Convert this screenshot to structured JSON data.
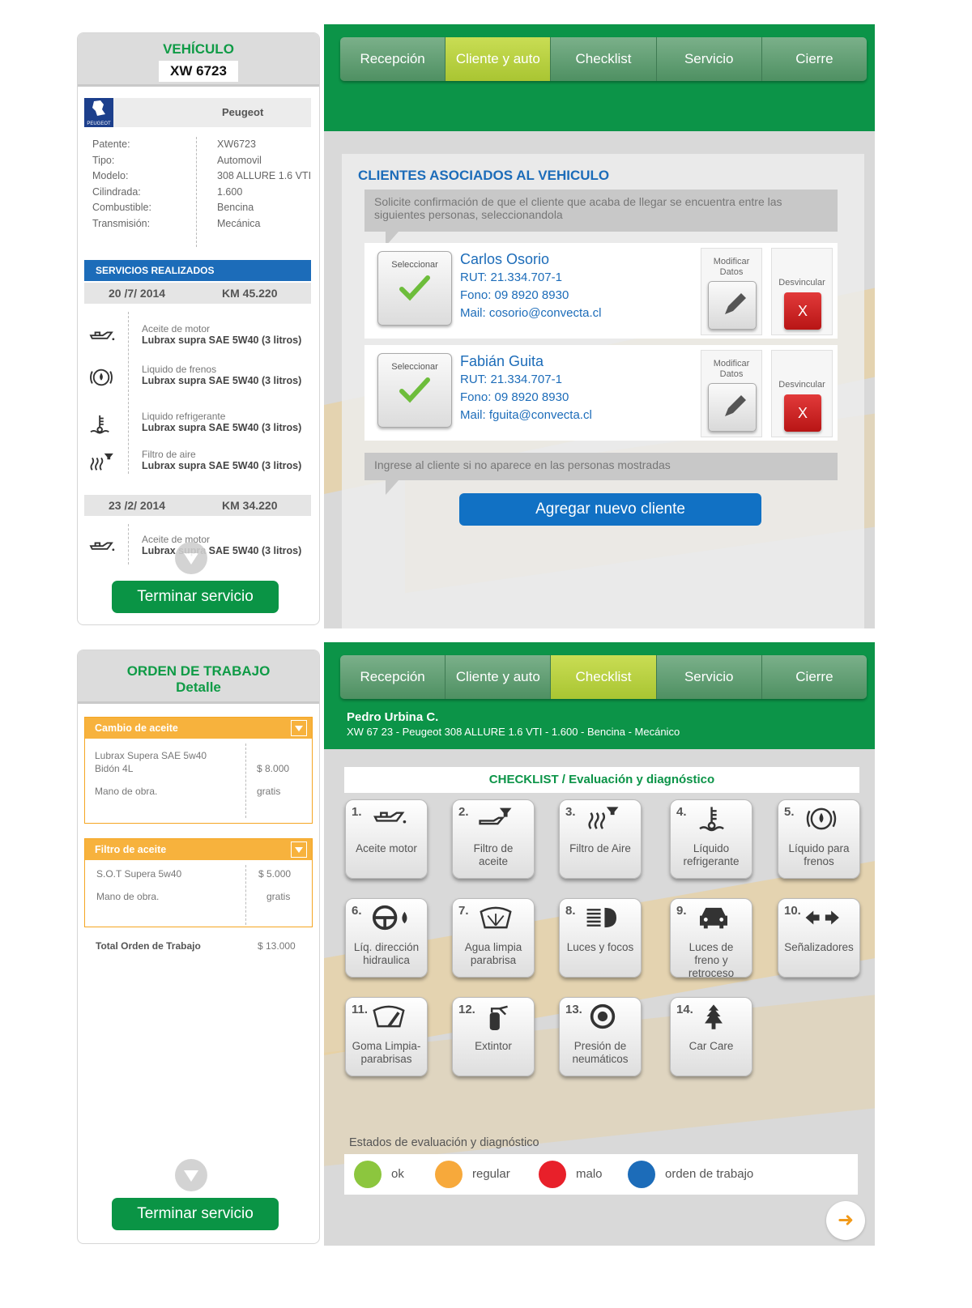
{
  "screen1": {
    "vehicle_title": "VEHÍCULO",
    "plate": "XW 6723",
    "brand": "Peugeot",
    "logo_text": "PEUGEOT",
    "specs": [
      {
        "label": "Patente:",
        "value": "XW6723"
      },
      {
        "label": "Tipo:",
        "value": "Automovil"
      },
      {
        "label": "Modelo:",
        "value": "308 ALLURE 1.6 VTI"
      },
      {
        "label": "Cilindrada:",
        "value": "1.600"
      },
      {
        "label": "Combustible:",
        "value": "Bencina"
      },
      {
        "label": "Transmisión:",
        "value": "Mecánica"
      }
    ],
    "services_title": "SERVICIOS REALIZADOS",
    "visits": [
      {
        "date": "20 /7/ 2014",
        "km": "KM 45.220"
      },
      {
        "date": "23 /2/ 2014",
        "km": "KM 34.220"
      }
    ],
    "services": [
      {
        "label": "Aceite de motor",
        "value": "Lubrax supra SAE 5W40 (3 litros)",
        "icon": "oil-can-icon"
      },
      {
        "label": "Liquido de frenos",
        "value": "Lubrax supra SAE 5W40 (3 litros)",
        "icon": "brake-fluid-icon"
      },
      {
        "label": "Liquido refrigerante",
        "value": "Lubrax supra SAE 5W40 (3 litros)",
        "icon": "coolant-icon"
      },
      {
        "label": "Filtro de aire",
        "value": "Lubrax supra SAE 5W40 (3 litros)",
        "icon": "air-filter-icon"
      },
      {
        "label": "Aceite de motor",
        "value": "Lubrax supra SAE 5W40 (3 litros)",
        "icon": "oil-can-icon"
      }
    ],
    "finish_button": "Terminar servicio",
    "tabs": [
      "Recepción",
      "Cliente y auto",
      "Checklist",
      "Servicio",
      "Cierre"
    ],
    "active_tab": "Cliente y auto",
    "clients_title": "CLIENTES ASOCIADOS AL VEHICULO",
    "instruction": "Solicite confirmación de que el cliente que acaba de llegar se encuentra entre las siguientes personas, seleccionandola",
    "select_label": "Seleccionar",
    "modify_label": "Modificar Datos",
    "unlink_label": "Desvincular",
    "unlink_button": "X",
    "clients": [
      {
        "name": "Carlos Osorio",
        "rut": "RUT: 21.334.707-1",
        "phone": "Fono: 09 8920 8930",
        "mail": "Mail: cosorio@convecta.cl"
      },
      {
        "name": "Fabián Guita",
        "rut": "RUT: 21.334.707-1",
        "phone": "Fono: 09 8920 8930",
        "mail": "Mail: fguita@convecta.cl"
      }
    ],
    "add_instruction": "Ingrese al cliente si no aparece en las personas mostradas",
    "add_button": "Agregar nuevo cliente"
  },
  "screen2": {
    "order_title": "ORDEN DE TRABAJO",
    "order_subtitle": "Detalle",
    "order_items": [
      {
        "title": "Cambio de aceite",
        "lines": [
          {
            "label": "Lubrax Supera SAE 5w40",
            "value": "$ 8.000"
          },
          {
            "label": "Bidón 4L",
            "value": ""
          },
          {
            "label": "Mano de obra.",
            "value": "gratis"
          }
        ]
      },
      {
        "title": "Filtro de aceite",
        "lines": [
          {
            "label": "S.O.T Supera 5w40",
            "value": "$ 5.000"
          },
          {
            "label": "Mano de obra.",
            "value": "gratis"
          }
        ]
      }
    ],
    "total_label": "Total Orden de Trabajo",
    "total_value": "$ 13.000",
    "finish_button": "Terminar servicio",
    "tabs": [
      "Recepción",
      "Cliente y auto",
      "Checklist",
      "Servicio",
      "Cierre"
    ],
    "active_tab": "Checklist",
    "customer_name": "Pedro Urbina C.",
    "vehicle_line": "XW 67 23 - Peugeot 308 ALLURE 1.6 VTI - 1.600 - Bencina - Mecánico",
    "checklist_title": "CHECKLIST / Evaluación y diagnóstico",
    "checklist": [
      {
        "num": "1.",
        "label": "Aceite motor",
        "icon": "oil-can-icon"
      },
      {
        "num": "2.",
        "label": "Filtro de aceite",
        "icon": "oil-filter-icon"
      },
      {
        "num": "3.",
        "label": "Filtro de Aire",
        "icon": "air-filter-icon"
      },
      {
        "num": "4.",
        "label": "Líquido refrigerante",
        "icon": "coolant-icon"
      },
      {
        "num": "5.",
        "label": "Líquido para frenos",
        "icon": "brake-fluid-icon"
      },
      {
        "num": "6.",
        "label": "Líq. dirección hidraulica",
        "icon": "steering-fluid-icon"
      },
      {
        "num": "7.",
        "label": "Agua limpia parabrisa",
        "icon": "washer-fluid-icon"
      },
      {
        "num": "8.",
        "label": "Luces y focos",
        "icon": "headlight-icon"
      },
      {
        "num": "9.",
        "label": "Luces de freno y retroceso",
        "icon": "car-lights-icon"
      },
      {
        "num": "10.",
        "label": "Señalizadores",
        "icon": "turn-signal-icon"
      },
      {
        "num": "11.",
        "label": "Goma Limpia-parabrisas",
        "icon": "wiper-icon"
      },
      {
        "num": "12.",
        "label": "Extintor",
        "icon": "extinguisher-icon"
      },
      {
        "num": "13.",
        "label": "Presión de neumáticos",
        "icon": "tire-icon"
      },
      {
        "num": "14.",
        "label": "Car Care",
        "icon": "air-freshener-icon"
      }
    ],
    "legend_title": "Estados de evaluación y diagnóstico",
    "legend": [
      {
        "label": "ok",
        "color": "#8cc63e"
      },
      {
        "label": "regular",
        "color": "#f7a93b"
      },
      {
        "label": "malo",
        "color": "#e8202a"
      },
      {
        "label": "orden de trabajo",
        "color": "#1c6cb9"
      }
    ]
  }
}
